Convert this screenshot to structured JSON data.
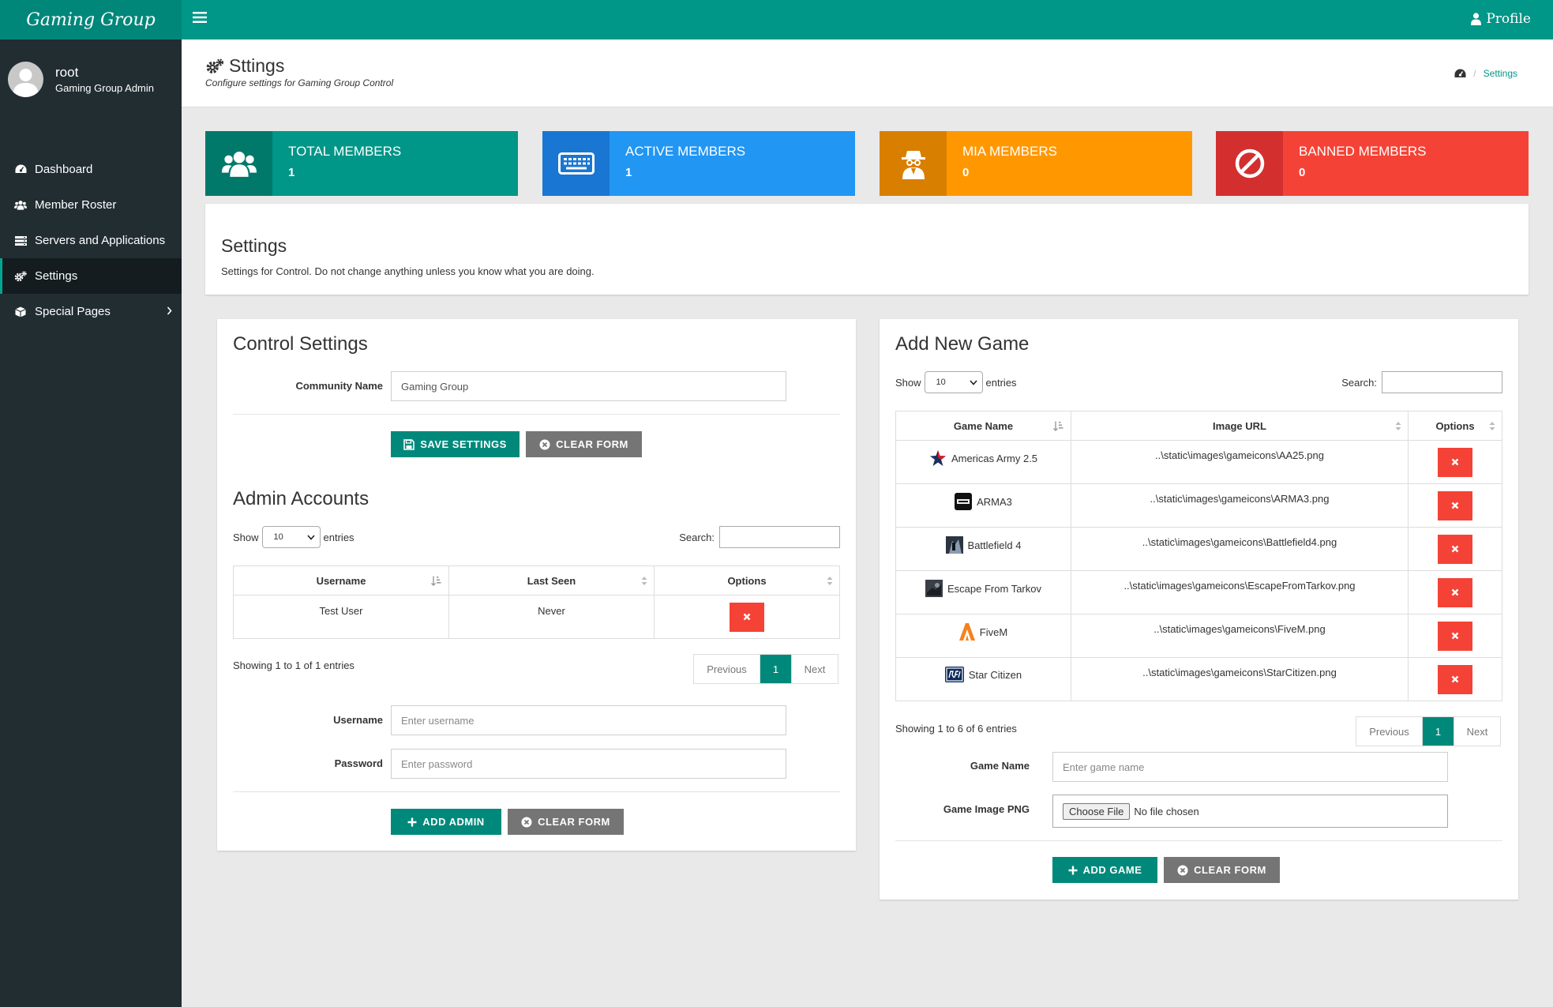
{
  "brand": "Gaming Group",
  "topbar": {
    "profile": "Profile"
  },
  "user": {
    "name": "root",
    "role": "Gaming Group Admin"
  },
  "nav": [
    {
      "label": "Dashboard",
      "icon": "dashboard-icon"
    },
    {
      "label": "Member Roster",
      "icon": "users-icon"
    },
    {
      "label": "Servers and Applications",
      "icon": "server-icon"
    },
    {
      "label": "Settings",
      "icon": "cogs-icon",
      "active": true
    },
    {
      "label": "Special Pages",
      "icon": "cube-icon"
    }
  ],
  "header": {
    "title": "Sttings",
    "subtitle": "Configure settings for Gaming Group Control",
    "breadcrumb": "Settings"
  },
  "stats": [
    {
      "label": "TOTAL MEMBERS",
      "value": "1",
      "color": "#009688",
      "dark": "#00796b",
      "icon": "users-icon"
    },
    {
      "label": "ACTIVE MEMBERS",
      "value": "1",
      "color": "#2196f3",
      "dark": "#1976d2",
      "icon": "keyboard-icon"
    },
    {
      "label": "MIA MEMBERS",
      "value": "0",
      "color": "#ff9800",
      "dark": "#d97f00",
      "icon": "user-secret-icon"
    },
    {
      "label": "BANNED MEMBERS",
      "value": "0",
      "color": "#f44336",
      "dark": "#d32f2f",
      "icon": "ban-icon"
    }
  ],
  "intro": {
    "title": "Settings",
    "desc": "Settings for Control. Do not change anything unless you know what you are doing."
  },
  "control": {
    "title": "Control Settings",
    "community_label": "Community Name",
    "community_value": "Gaming Group",
    "save": "SAVE SETTINGS",
    "clear": "CLEAR FORM"
  },
  "admins": {
    "title": "Admin Accounts",
    "show": "Show",
    "entries_value": "10",
    "entries": "entries",
    "search": "Search:",
    "columns": [
      "Username",
      "Last Seen",
      "Options"
    ],
    "rows": [
      {
        "username": "Test User",
        "last_seen": "Never"
      }
    ],
    "info": "Showing 1 to 1 of 1 entries",
    "prev": "Previous",
    "page": "1",
    "next": "Next",
    "username_label": "Username",
    "username_ph": "Enter username",
    "password_label": "Password",
    "password_ph": "Enter password",
    "add": "ADD ADMIN",
    "clear": "CLEAR FORM"
  },
  "games": {
    "title": "Add New Game",
    "show": "Show",
    "entries_value": "10",
    "entries": "entries",
    "search": "Search:",
    "columns": [
      "Game Name",
      "Image URL",
      "Options"
    ],
    "rows": [
      {
        "name": "Americas Army 2.5",
        "url": "..\\static\\images\\gameicons\\AA25.png",
        "icon": "americas-army-icon"
      },
      {
        "name": "ARMA3",
        "url": "..\\static\\images\\gameicons\\ARMA3.png",
        "icon": "arma3-icon"
      },
      {
        "name": "Battlefield 4",
        "url": "..\\static\\images\\gameicons\\Battlefield4.png",
        "icon": "battlefield4-icon"
      },
      {
        "name": "Escape From Tarkov",
        "url": "..\\static\\images\\gameicons\\EscapeFromTarkov.png",
        "icon": "tarkov-icon"
      },
      {
        "name": "FiveM",
        "url": "..\\static\\images\\gameicons\\FiveM.png",
        "icon": "fivem-icon"
      },
      {
        "name": "Star Citizen",
        "url": "..\\static\\images\\gameicons\\StarCitizen.png",
        "icon": "star-citizen-icon"
      }
    ],
    "info": "Showing 1 to 6 of 6 entries",
    "prev": "Previous",
    "page": "1",
    "next": "Next",
    "name_label": "Game Name",
    "name_ph": "Enter game name",
    "image_label": "Game Image PNG",
    "choose": "Choose File",
    "no_file": "No file chosen",
    "add": "ADD GAME",
    "clear": "CLEAR FORM"
  }
}
